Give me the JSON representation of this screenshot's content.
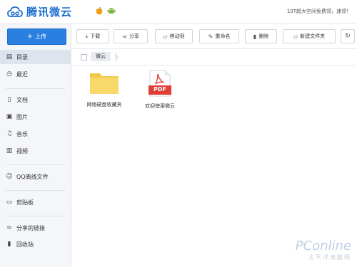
{
  "app": {
    "logo_text": "腾讯微云",
    "promo_text": "10T超大空间免费领，速领！"
  },
  "sidebar": {
    "upload_label": "上传",
    "items": [
      {
        "label": "目录",
        "icon": "directory-icon"
      },
      {
        "label": "最近",
        "icon": "clock-icon"
      },
      {
        "label": "文档",
        "icon": "document-icon"
      },
      {
        "label": "图片",
        "icon": "picture-icon"
      },
      {
        "label": "音乐",
        "icon": "music-icon"
      },
      {
        "label": "视频",
        "icon": "video-icon"
      },
      {
        "label": "QQ离线文件",
        "icon": "qq-icon"
      },
      {
        "label": "剪贴板",
        "icon": "clipboard-icon"
      },
      {
        "label": "分享的链接",
        "icon": "link-icon"
      },
      {
        "label": "回收站",
        "icon": "trash-icon"
      }
    ]
  },
  "toolbar": {
    "download": "下载",
    "share": "分享",
    "move": "移动到",
    "rename": "重命名",
    "delete": "删除",
    "new_folder": "新建文件夹"
  },
  "breadcrumb": {
    "current": "微云"
  },
  "files": [
    {
      "name": "网络硬盘收藏夹",
      "type": "folder"
    },
    {
      "name": "欢迎使用微云",
      "type": "pdf",
      "badge": "PDF"
    }
  ],
  "watermark": {
    "line1": "PConline",
    "line2": "太平洋电脑网"
  },
  "colors": {
    "accent": "#2a7fe0",
    "folder": "#f8d86a",
    "pdf_red": "#e03e35"
  }
}
